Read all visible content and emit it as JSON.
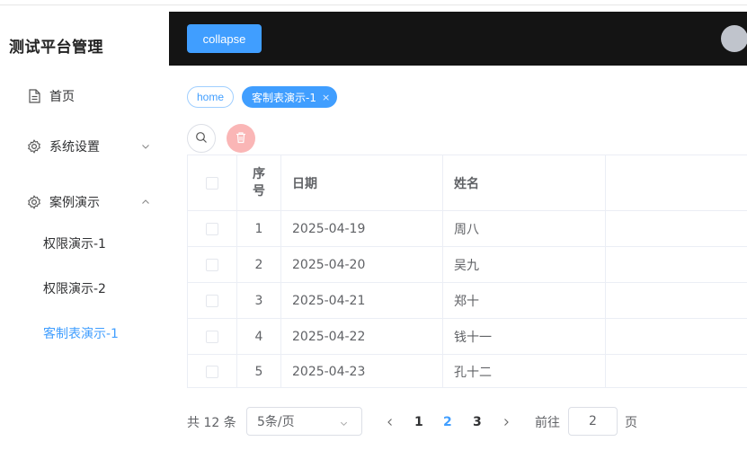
{
  "app": {
    "title": "测试平台管理"
  },
  "sidebar": {
    "items": [
      {
        "label": "首页",
        "icon": "document-icon"
      },
      {
        "label": "系统设置",
        "icon": "gear-icon",
        "expanded": false
      },
      {
        "label": "案例演示",
        "icon": "gear-icon",
        "expanded": true
      }
    ],
    "subitems": [
      {
        "label": "权限演示-1",
        "active": false
      },
      {
        "label": "权限演示-2",
        "active": false
      },
      {
        "label": "客制表演示-1",
        "active": true
      }
    ]
  },
  "header": {
    "collapse_label": "collapse"
  },
  "tabs": [
    {
      "label": "home",
      "active": false
    },
    {
      "label": "客制表演示-1",
      "active": true,
      "close_icon": "×"
    }
  ],
  "table": {
    "columns": {
      "index": "序号",
      "index_line1": "序",
      "index_line2": "号",
      "date": "日期",
      "name": "姓名"
    },
    "rows": [
      {
        "index": "1",
        "date": "2025-04-19",
        "name": "周八"
      },
      {
        "index": "2",
        "date": "2025-04-20",
        "name": "吴九"
      },
      {
        "index": "3",
        "date": "2025-04-21",
        "name": "郑十"
      },
      {
        "index": "4",
        "date": "2025-04-22",
        "name": "钱十一"
      },
      {
        "index": "5",
        "date": "2025-04-23",
        "name": "孔十二"
      }
    ]
  },
  "pagination": {
    "total": "共 12 条",
    "page_size": "5条/页",
    "pages": [
      "1",
      "2",
      "3"
    ],
    "current": "2",
    "goto_label": "前往",
    "goto_value": "2",
    "page_unit": "页"
  },
  "colors": {
    "accent": "#409eff",
    "header_bg": "#141414",
    "danger_light": "#fab6b6"
  }
}
